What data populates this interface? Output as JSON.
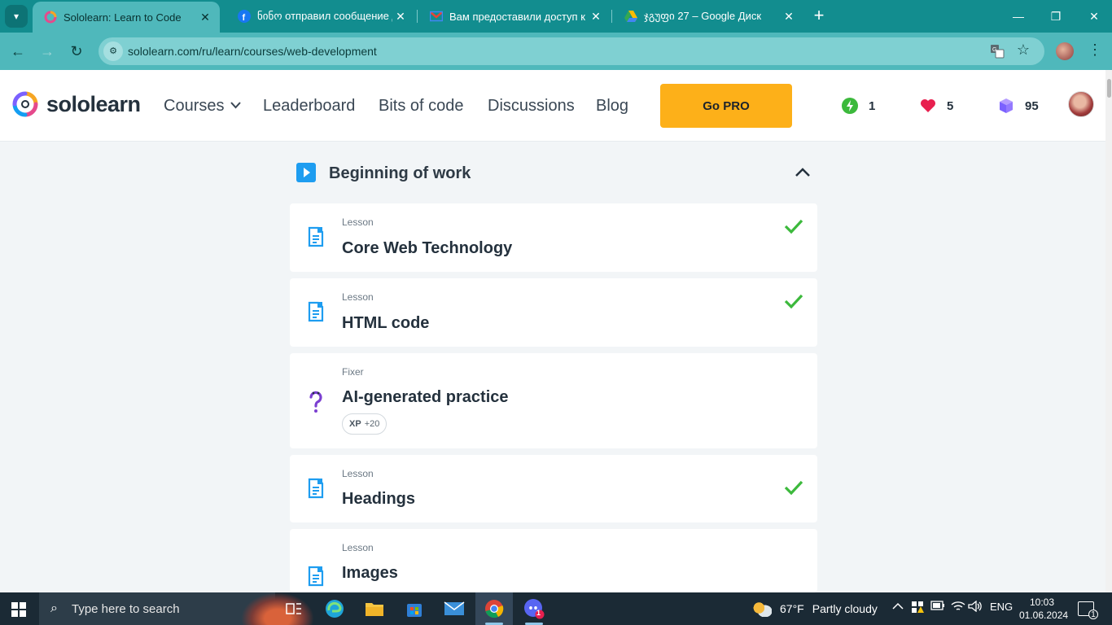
{
  "browser": {
    "tabs": [
      {
        "title": "Sololearn: Learn to Code",
        "active": true
      },
      {
        "title": "ნინო отправил сообщение д",
        "active": false
      },
      {
        "title": "Вам предоставили доступ к па",
        "active": false
      },
      {
        "title": "ჯგუფი 27 – Google Диск",
        "active": false
      }
    ],
    "url": "sololearn.com/ru/learn/courses/web-development"
  },
  "header": {
    "logo_text": "sololearn",
    "nav": {
      "courses": "Courses",
      "leaderboard": "Leaderboard",
      "bits": "Bits of code",
      "discussions": "Discussions",
      "blog": "Blog"
    },
    "go_pro": "Go PRO",
    "streak": "1",
    "hearts": "5",
    "gems": "95"
  },
  "module": {
    "title": "Beginning of work",
    "items": [
      {
        "type": "Lesson",
        "name": "Core Web Technology",
        "completed": true
      },
      {
        "type": "Lesson",
        "name": "HTML code",
        "completed": true
      },
      {
        "type": "Fixer",
        "name": "AI-generated practice",
        "completed": false,
        "xp_label": "XP",
        "xp_value": "+20"
      },
      {
        "type": "Lesson",
        "name": "Headings",
        "completed": true
      },
      {
        "type": "Lesson",
        "name": "Images",
        "completed": false
      }
    ]
  },
  "taskbar": {
    "search_placeholder": "Type here to search",
    "weather_temp": "67°F",
    "weather_text": "Partly cloudy",
    "language": "ENG",
    "time": "10:03",
    "date": "01.06.2024",
    "notification_count": "1",
    "discord_badge": "1"
  },
  "colors": {
    "accent_teal": "#128d8f",
    "go_pro": "#fdb019",
    "check_green": "#3cb93c",
    "lesson_blue": "#1e9df0"
  }
}
